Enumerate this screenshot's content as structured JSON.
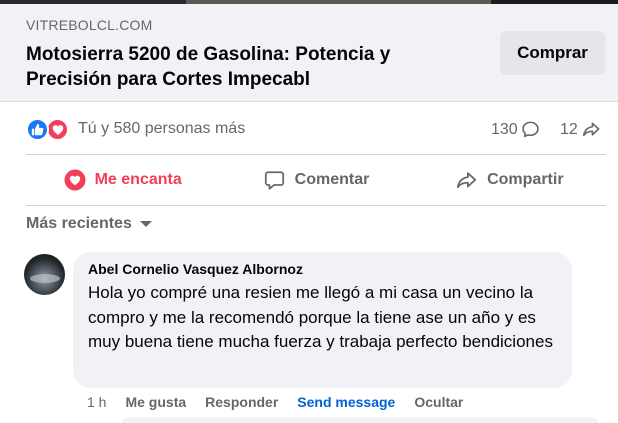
{
  "link_preview": {
    "domain": "VITREBOLCL.COM",
    "title": "Motosierra 5200 de Gasolina: Potencia y Precisión para Cortes Impecabl",
    "buy_label": "Comprar"
  },
  "reactions": {
    "summary": "Tú y 580 personas más",
    "comment_count": "130",
    "share_count": "12",
    "icons": [
      "like-icon",
      "love-icon"
    ]
  },
  "actions": {
    "love_label": "Me encanta",
    "comment_label": "Comentar",
    "share_label": "Compartir",
    "love_color": "#f33e58"
  },
  "comments": {
    "sort_label": "Más recientes",
    "items": [
      {
        "author": "Abel Cornelio Vasquez Albornoz",
        "text": "Hola yo compré una resien me llegó a mi casa un vecino la compro y me la recomendó porque la tiene ase un año y es muy buena tiene mucha fuerza y trabaja perfecto bendiciones",
        "time": "1 h",
        "like_label": "Me gusta",
        "reply_label": "Responder",
        "send_message_label": "Send message",
        "hide_label": "Ocultar"
      }
    ]
  },
  "colors": {
    "accent_blue": "#1877f2",
    "link_blue": "#0064d1",
    "muted_text": "#65676b",
    "bubble_bg": "#f0f2f5"
  }
}
